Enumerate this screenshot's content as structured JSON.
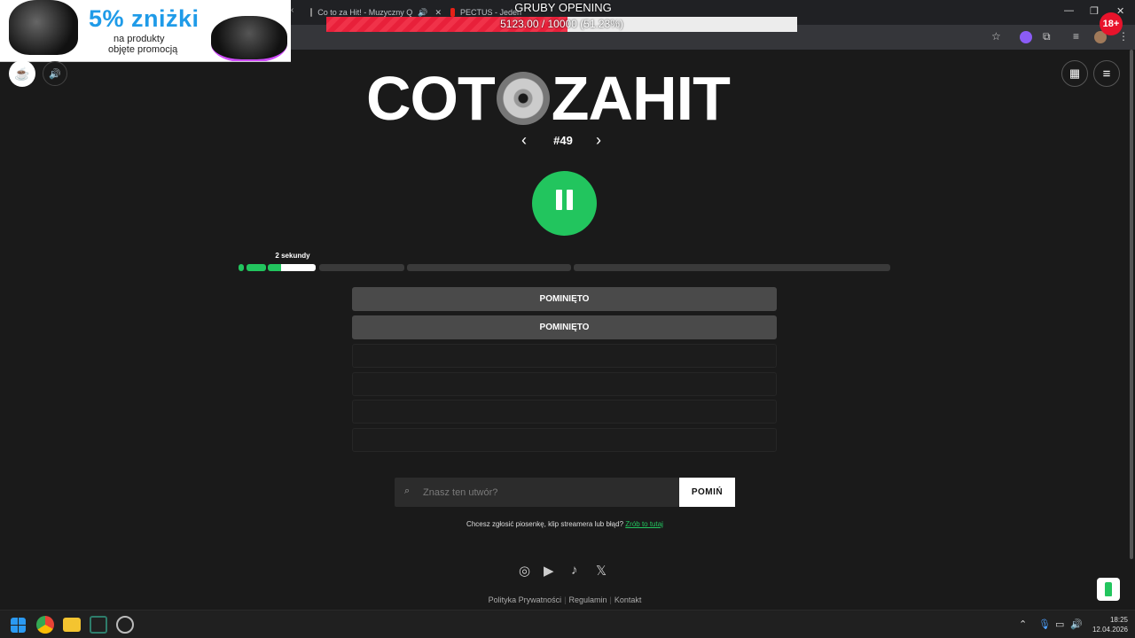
{
  "browser": {
    "tabs": [
      {
        "title": "Co to za Hit! - Muzyczny Q"
      },
      {
        "title": "PECTUS - Jeden"
      }
    ],
    "window_controls": {
      "minimize": "—",
      "restore": "❐",
      "close": "✕"
    }
  },
  "overlays": {
    "ad": {
      "percent": "5% zniżki",
      "line1": "na produkty",
      "line2": "objęte promocją"
    },
    "goal": {
      "title": "GRUBY OPENING",
      "text": "5123.00 / 10000 (51.23%)",
      "progress": 0.5123
    },
    "badge": "18+"
  },
  "page": {
    "logo": {
      "left": "COT",
      "right": "ZAHIT"
    },
    "puzzle_number": "#49",
    "progress": {
      "label": "2 sekundy",
      "played_seconds": 2
    },
    "answers": [
      {
        "text": "POMINIĘTO"
      },
      {
        "text": "POMINIĘTO"
      },
      {
        "text": ""
      },
      {
        "text": ""
      },
      {
        "text": ""
      },
      {
        "text": ""
      }
    ],
    "search": {
      "placeholder": "Znasz ten utwór?",
      "value": ""
    },
    "skip_button": "POMIŃ",
    "report": {
      "text": "Chcesz zgłosić piosenkę, klip streamera lub błąd?",
      "link": "Zrób to tutaj"
    },
    "footer": {
      "privacy": "Polityka Prywatności",
      "terms": "Regulamin",
      "contact": "Kontakt",
      "separator": "|"
    }
  },
  "taskbar": {
    "time": "18:25",
    "date": "12.04.2026"
  },
  "colors": {
    "accent": "#22c55e",
    "background": "#1a1a1a",
    "goal_bar": "#e8203a"
  }
}
